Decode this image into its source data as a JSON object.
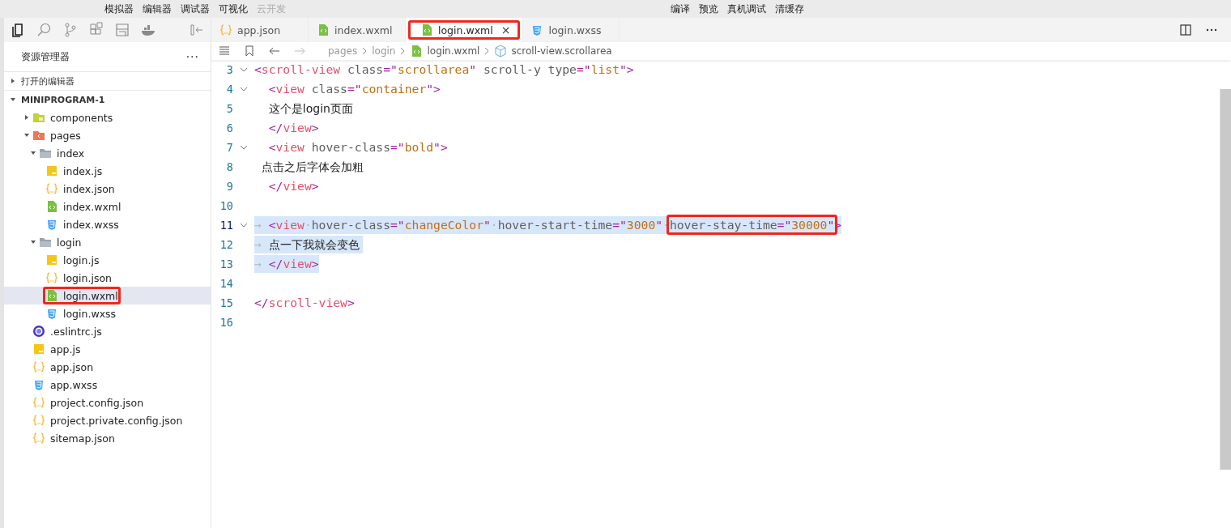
{
  "menu_bar": {
    "left": [
      {
        "label": "模拟器",
        "disabled": false
      },
      {
        "label": "编辑器",
        "disabled": false
      },
      {
        "label": "调试器",
        "disabled": false
      },
      {
        "label": "可视化",
        "disabled": false
      },
      {
        "label": "云开发",
        "disabled": true
      }
    ],
    "right": [
      {
        "label": "编译",
        "disabled": false
      },
      {
        "label": "预览",
        "disabled": false
      },
      {
        "label": "真机调试",
        "disabled": false
      },
      {
        "label": "清缓存",
        "disabled": false
      }
    ]
  },
  "activity_bar": [
    {
      "kind": "files",
      "selected": true
    },
    {
      "kind": "search",
      "selected": false
    },
    {
      "kind": "branch",
      "selected": false
    },
    {
      "kind": "grid",
      "selected": false
    },
    {
      "kind": "disk",
      "selected": false
    },
    {
      "kind": "whale",
      "selected": false
    }
  ],
  "explorer": {
    "title": "资源管理器",
    "more": "···",
    "sections": [
      {
        "label": "打开的编辑器",
        "expanded": false
      },
      {
        "label": "MINIPROGRAM-1",
        "expanded": true
      }
    ],
    "tree": [
      {
        "name": "components",
        "kind": "folder-components",
        "expanded": false,
        "selected": false
      },
      {
        "name": "pages",
        "kind": "folder-pages",
        "expanded": true,
        "selected": false,
        "children": [
          {
            "name": "index",
            "kind": "folder",
            "expanded": true,
            "selected": false,
            "children": [
              {
                "name": "index.js",
                "kind": "js",
                "selected": false
              },
              {
                "name": "index.json",
                "kind": "json",
                "selected": false
              },
              {
                "name": "index.wxml",
                "kind": "wxml",
                "selected": false
              },
              {
                "name": "index.wxss",
                "kind": "wxss",
                "selected": false
              }
            ]
          },
          {
            "name": "login",
            "kind": "folder",
            "expanded": true,
            "selected": false,
            "children": [
              {
                "name": "login.js",
                "kind": "js",
                "selected": false
              },
              {
                "name": "login.json",
                "kind": "json",
                "selected": false
              },
              {
                "name": "login.wxml",
                "kind": "wxml",
                "selected": true,
                "annotated": true
              },
              {
                "name": "login.wxss",
                "kind": "wxss",
                "selected": false
              }
            ]
          }
        ]
      },
      {
        "name": ".eslintrc.js",
        "kind": "eslint",
        "selected": false
      },
      {
        "name": "app.js",
        "kind": "js",
        "selected": false
      },
      {
        "name": "app.json",
        "kind": "json",
        "selected": false
      },
      {
        "name": "app.wxss",
        "kind": "wxss",
        "selected": false
      },
      {
        "name": "project.config.json",
        "kind": "json",
        "selected": false
      },
      {
        "name": "project.private.config.json",
        "kind": "json",
        "selected": false
      },
      {
        "name": "sitemap.json",
        "kind": "json",
        "selected": false
      }
    ]
  },
  "tabs": [
    {
      "label": "app.json",
      "kind": "json",
      "selected": false
    },
    {
      "label": "index.wxml",
      "kind": "wxml",
      "selected": false
    },
    {
      "label": "login.wxml",
      "kind": "wxml",
      "selected": true,
      "close": "×",
      "annotated": true
    },
    {
      "label": "login.wxss",
      "kind": "wxss",
      "selected": false
    }
  ],
  "breadcrumb": [
    {
      "label": "pages",
      "kind": "folder"
    },
    {
      "label": "login",
      "kind": "folder"
    },
    {
      "label": "login.wxml",
      "kind": "wxml"
    },
    {
      "label": "scroll-view.scrollarea",
      "kind": "element"
    }
  ],
  "code_lines": [
    {
      "number": "3",
      "fold": true,
      "current": false,
      "selected": false,
      "tokens": [
        {
          "kind": "punct",
          "text": "<"
        },
        {
          "kind": "tag",
          "text": "scroll-view"
        },
        {
          "kind": "attr",
          "text": " class"
        },
        {
          "kind": "punct",
          "text": "=\""
        },
        {
          "kind": "str",
          "text": "scrollarea"
        },
        {
          "kind": "punct",
          "text": "\""
        },
        {
          "kind": "attr",
          "text": " scroll-y type"
        },
        {
          "kind": "punct",
          "text": "=\""
        },
        {
          "kind": "str",
          "text": "list"
        },
        {
          "kind": "punct",
          "text": "\">"
        }
      ]
    },
    {
      "number": "4",
      "fold": true,
      "current": false,
      "selected": false,
      "tokens": [
        {
          "kind": "punct",
          "text": "  <"
        },
        {
          "kind": "tag",
          "text": "view"
        },
        {
          "kind": "attr",
          "text": " class"
        },
        {
          "kind": "punct",
          "text": "=\""
        },
        {
          "kind": "str",
          "text": "container"
        },
        {
          "kind": "punct",
          "text": "\">"
        }
      ]
    },
    {
      "number": "5",
      "fold": false,
      "current": false,
      "selected": false,
      "tokens": [
        {
          "kind": "text",
          "text": "    这个是login页面"
        }
      ]
    },
    {
      "number": "6",
      "fold": false,
      "current": false,
      "selected": false,
      "tokens": [
        {
          "kind": "punct",
          "text": "  </"
        },
        {
          "kind": "tag",
          "text": "view"
        },
        {
          "kind": "punct",
          "text": ">"
        }
      ]
    },
    {
      "number": "7",
      "fold": true,
      "current": false,
      "selected": false,
      "tokens": [
        {
          "kind": "punct",
          "text": "  <"
        },
        {
          "kind": "tag",
          "text": "view"
        },
        {
          "kind": "attr",
          "text": " hover-class"
        },
        {
          "kind": "punct",
          "text": "=\""
        },
        {
          "kind": "str",
          "text": "bold"
        },
        {
          "kind": "punct",
          "text": "\">"
        }
      ]
    },
    {
      "number": "8",
      "fold": false,
      "current": false,
      "selected": false,
      "tokens": [
        {
          "kind": "text",
          "text": "  点击之后字体会加粗"
        }
      ]
    },
    {
      "number": "9",
      "fold": false,
      "current": false,
      "selected": false,
      "tokens": [
        {
          "kind": "punct",
          "text": "  </"
        },
        {
          "kind": "tag",
          "text": "view"
        },
        {
          "kind": "punct",
          "text": ">"
        }
      ]
    },
    {
      "number": "10",
      "fold": false,
      "current": false
    },
    {
      "number": "11",
      "fold": true,
      "current": true,
      "selected": true,
      "tokens": [
        {
          "kind": "ws",
          "text": "→ "
        },
        {
          "kind": "punct",
          "text": "<"
        },
        {
          "kind": "tag",
          "text": "view"
        },
        {
          "kind": "ws",
          "text": "·"
        },
        {
          "kind": "attr",
          "text": "hover-class"
        },
        {
          "kind": "punct",
          "text": "=\""
        },
        {
          "kind": "str",
          "text": "changeColor"
        },
        {
          "kind": "punct",
          "text": "\""
        },
        {
          "kind": "ws",
          "text": "·"
        },
        {
          "kind": "attr",
          "text": "hover-start-time"
        },
        {
          "kind": "punct",
          "text": "=\""
        },
        {
          "kind": "str",
          "text": "3000"
        },
        {
          "kind": "punct",
          "text": "\""
        },
        {
          "kind": "ws",
          "text": "·"
        },
        {
          "kind": "attr",
          "text": "hover-stay-time",
          "boxed": true
        },
        {
          "kind": "punct",
          "text": "=\"",
          "boxed": true
        },
        {
          "kind": "str",
          "text": "30000",
          "boxed": true
        },
        {
          "kind": "punct",
          "text": "\"",
          "boxed": true
        },
        {
          "kind": "punct",
          "text": ">"
        }
      ]
    },
    {
      "number": "12",
      "fold": false,
      "current": false,
      "selected": true,
      "tokens": [
        {
          "kind": "ws",
          "text": "→ "
        },
        {
          "kind": "text",
          "text": "点一下我就会变色 "
        }
      ]
    },
    {
      "number": "13",
      "fold": false,
      "current": false,
      "selected": true,
      "tokens": [
        {
          "kind": "ws",
          "text": "→ "
        },
        {
          "kind": "punct",
          "text": "</"
        },
        {
          "kind": "tag",
          "text": "view"
        },
        {
          "kind": "punct",
          "text": ">"
        }
      ]
    },
    {
      "number": "14",
      "fold": false,
      "current": false
    },
    {
      "number": "15",
      "fold": false,
      "current": false,
      "selected": false,
      "tokens": [
        {
          "kind": "punct",
          "text": "</"
        },
        {
          "kind": "tag",
          "text": "scroll-view"
        },
        {
          "kind": "punct",
          "text": ">"
        }
      ]
    },
    {
      "number": "16",
      "fold": false,
      "current": false
    }
  ]
}
